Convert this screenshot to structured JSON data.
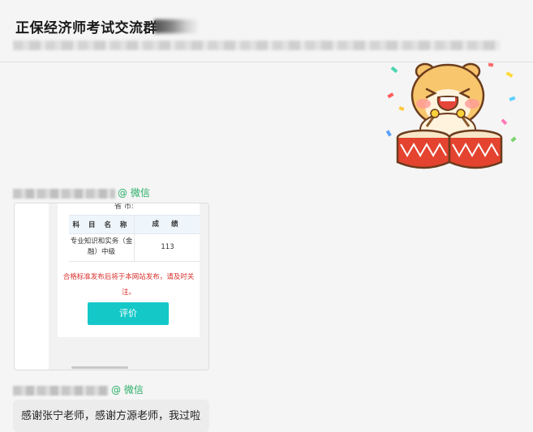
{
  "header": {
    "title": "正保经济师考试交流群"
  },
  "messages": [
    {
      "sender_suffix": "@ 微信",
      "card": {
        "province_label": "省    市:",
        "table_headers": [
          "科 目 名 称",
          "成 绩"
        ],
        "rows": [
          {
            "subject": "专业知识和实务（金融）中级",
            "score": "113"
          }
        ],
        "notice": "合格标准发布后将于本网站发布，请及时关注。",
        "button_label": "评价"
      }
    },
    {
      "sender_suffix": "@ 微信",
      "text": "感谢张宁老师，感谢方源老师，我过啦"
    }
  ],
  "colors": {
    "accent_green": "#2aae67",
    "button_teal": "#15c8c8",
    "notice_red": "#d9302b"
  },
  "icons": [
    "hamster-drum-sticker"
  ]
}
